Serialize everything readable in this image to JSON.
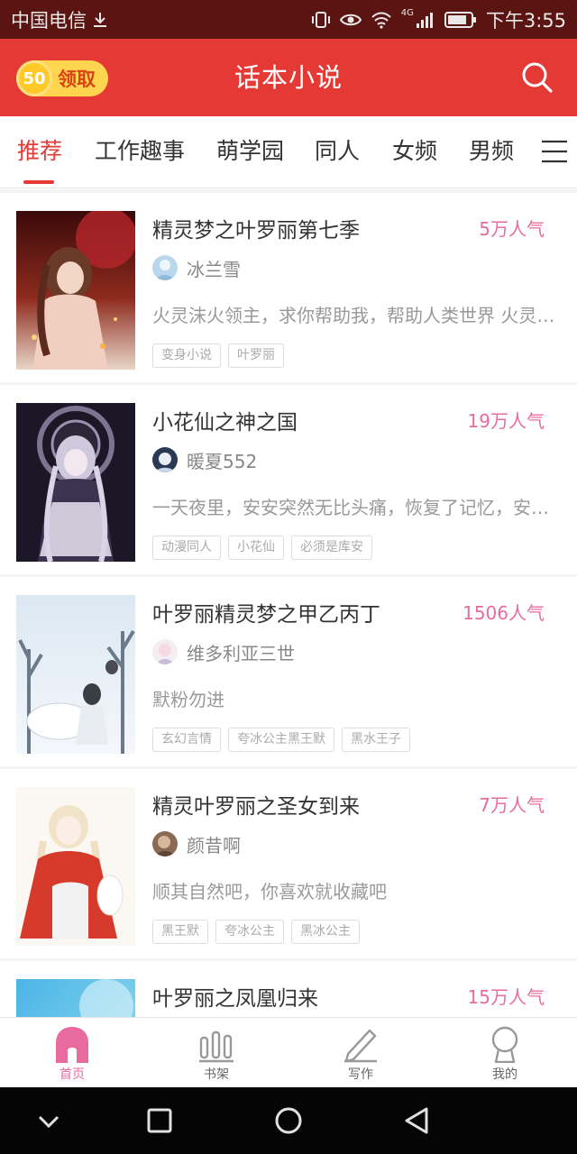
{
  "status_bar": {
    "carrier": "中国电信",
    "network": "4G",
    "time": "下午3:55"
  },
  "header": {
    "title": "话本小说",
    "reward_amount": "50",
    "reward_label": "领取"
  },
  "tabs": [
    {
      "label": "推荐",
      "active": true
    },
    {
      "label": "工作趣事"
    },
    {
      "label": "萌学园"
    },
    {
      "label": "同人"
    },
    {
      "label": "女频"
    },
    {
      "label": "男频"
    }
  ],
  "books": [
    {
      "title": "精灵梦之叶罗丽第七季",
      "popularity": "5万人气",
      "author": "冰兰雪",
      "description": "火灵沫火领主，求你帮助我，帮助人类世界 火灵沫火领主…",
      "tags": [
        "变身小说",
        "叶罗丽"
      ]
    },
    {
      "title": "小花仙之神之国",
      "popularity": "19万人气",
      "author": "暖夏552",
      "description": "一天夜里，安安突然无比头痛，恢复了记忆，安安突然…",
      "tags": [
        "动漫同人",
        "小花仙",
        "必须是库安"
      ]
    },
    {
      "title": "叶罗丽精灵梦之甲乙丙丁",
      "popularity": "1506人气",
      "author": "维多利亚三世",
      "description": "默粉勿进",
      "tags": [
        "玄幻言情",
        "夸冰公主黑王默",
        "黑水王子"
      ]
    },
    {
      "title": "精灵叶罗丽之圣女到来",
      "popularity": "7万人气",
      "author": "颜昔啊",
      "description": "顺其自然吧，你喜欢就收藏吧",
      "tags": [
        "黑王默",
        "夸冰公主",
        "黑冰公主"
      ]
    },
    {
      "title": "叶罗丽之凤凰归来",
      "popularity": "15万人气"
    }
  ],
  "bottom_nav": [
    {
      "label": "首页",
      "icon": "home-icon",
      "active": true
    },
    {
      "label": "书架",
      "icon": "bookshelf-icon"
    },
    {
      "label": "写作",
      "icon": "pencil-icon"
    },
    {
      "label": "我的",
      "icon": "profile-icon"
    }
  ],
  "colors": {
    "brand_red": "#e53935",
    "status_bar": "#5a1412",
    "popularity_pink": "#e86b9f"
  }
}
